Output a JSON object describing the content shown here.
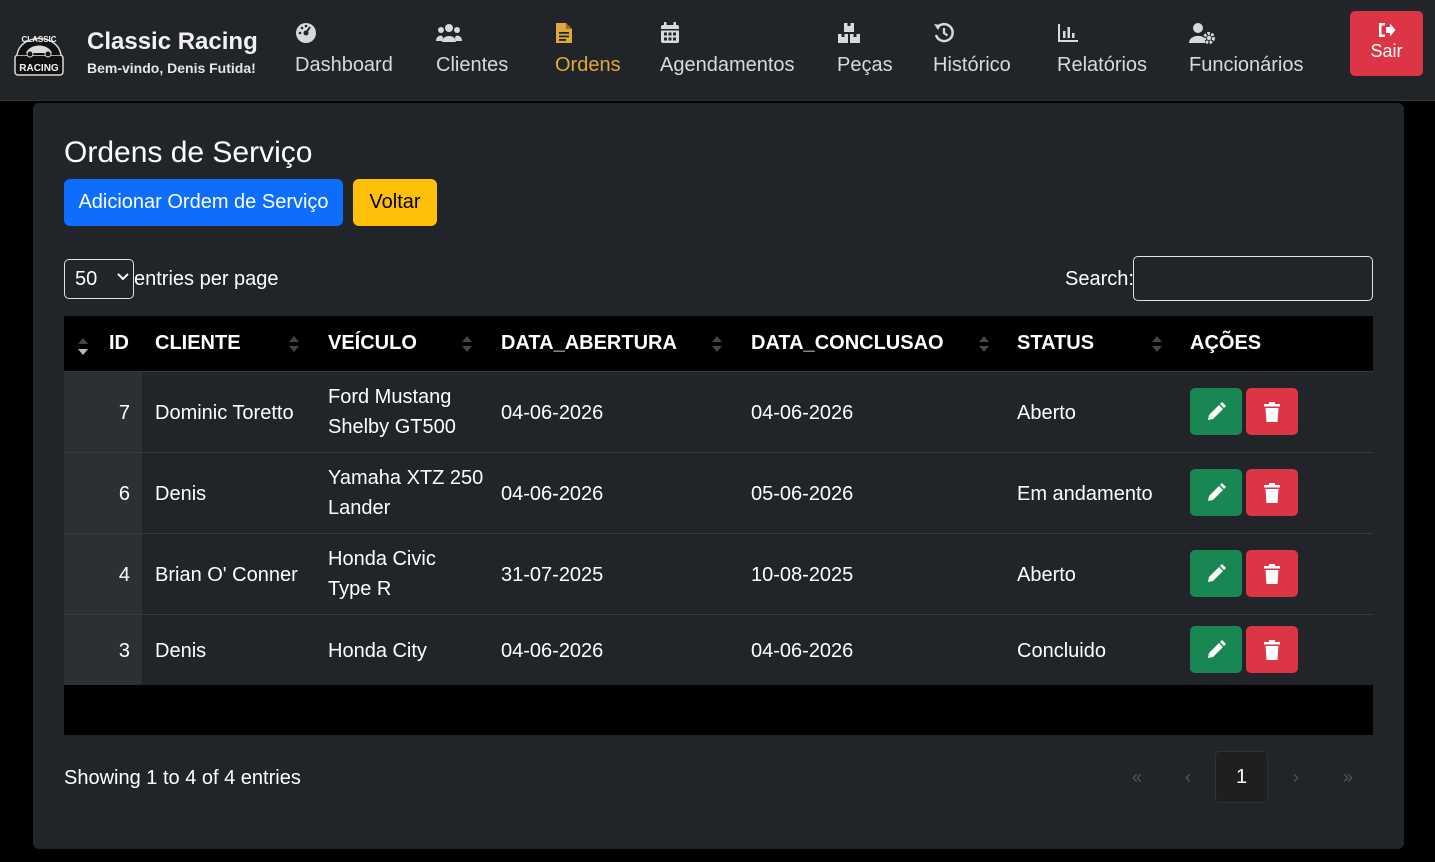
{
  "brand": {
    "title": "Classic Racing",
    "subtitle": "Bem-vindo, Denis Futida!",
    "logo_text_top": "CLASSIC",
    "logo_text_bottom": "RACING"
  },
  "nav": {
    "items": [
      {
        "label": "Dashboard",
        "icon": "gauge-icon"
      },
      {
        "label": "Clientes",
        "icon": "users-icon"
      },
      {
        "label": "Ordens",
        "icon": "file-text-icon",
        "active": true
      },
      {
        "label": "Agendamentos",
        "icon": "calendar-icon"
      },
      {
        "label": "Peças",
        "icon": "boxes-icon"
      },
      {
        "label": "Histórico",
        "icon": "history-icon"
      },
      {
        "label": "Relatórios",
        "icon": "bar-chart-icon"
      },
      {
        "label": "Funcionários",
        "icon": "user-gear-icon"
      }
    ],
    "logout_label": "Sair"
  },
  "page": {
    "title": "Ordens de Serviço",
    "add_button": "Adicionar Ordem de Serviço",
    "back_button": "Voltar"
  },
  "table_controls": {
    "per_page_value": "50",
    "per_page_label": "entries per page",
    "search_label": "Search:",
    "search_value": ""
  },
  "table": {
    "columns": [
      "ID",
      "CLIENTE",
      "VEÍCULO",
      "DATA_ABERTURA",
      "DATA_CONCLUSAO",
      "STATUS",
      "AÇÕES"
    ],
    "rows": [
      {
        "id": "7",
        "cliente": "Dominic Toretto",
        "veiculo_l1": "Ford Mustang",
        "veiculo_l2": "Shelby GT500",
        "abertura": "04-06-2026",
        "conclusao": "04-06-2026",
        "status": "Aberto"
      },
      {
        "id": "6",
        "cliente": "Denis",
        "veiculo_l1": "Yamaha XTZ 250",
        "veiculo_l2": "Lander",
        "abertura": "04-06-2026",
        "conclusao": "05-06-2026",
        "status": "Em andamento"
      },
      {
        "id": "4",
        "cliente": "Brian O' Conner",
        "veiculo_l1": "Honda Civic",
        "veiculo_l2": "Type R",
        "abertura": "31-07-2025",
        "conclusao": "10-08-2025",
        "status": "Aberto"
      },
      {
        "id": "3",
        "cliente": "Denis",
        "veiculo_l1": "Honda City",
        "veiculo_l2": "",
        "abertura": "04-06-2026",
        "conclusao": "04-06-2026",
        "status": "Concluido"
      }
    ]
  },
  "footer": {
    "info": "Showing 1 to 4 of 4 entries",
    "pagination": {
      "first": "«",
      "prev": "‹",
      "current": "1",
      "next": "›",
      "last": "»"
    }
  },
  "colors": {
    "primary": "#0d6efd",
    "warning": "#ffc107",
    "danger": "#dc3545",
    "success": "#198754",
    "active_nav": "#e0a83a",
    "surface": "#212529"
  }
}
